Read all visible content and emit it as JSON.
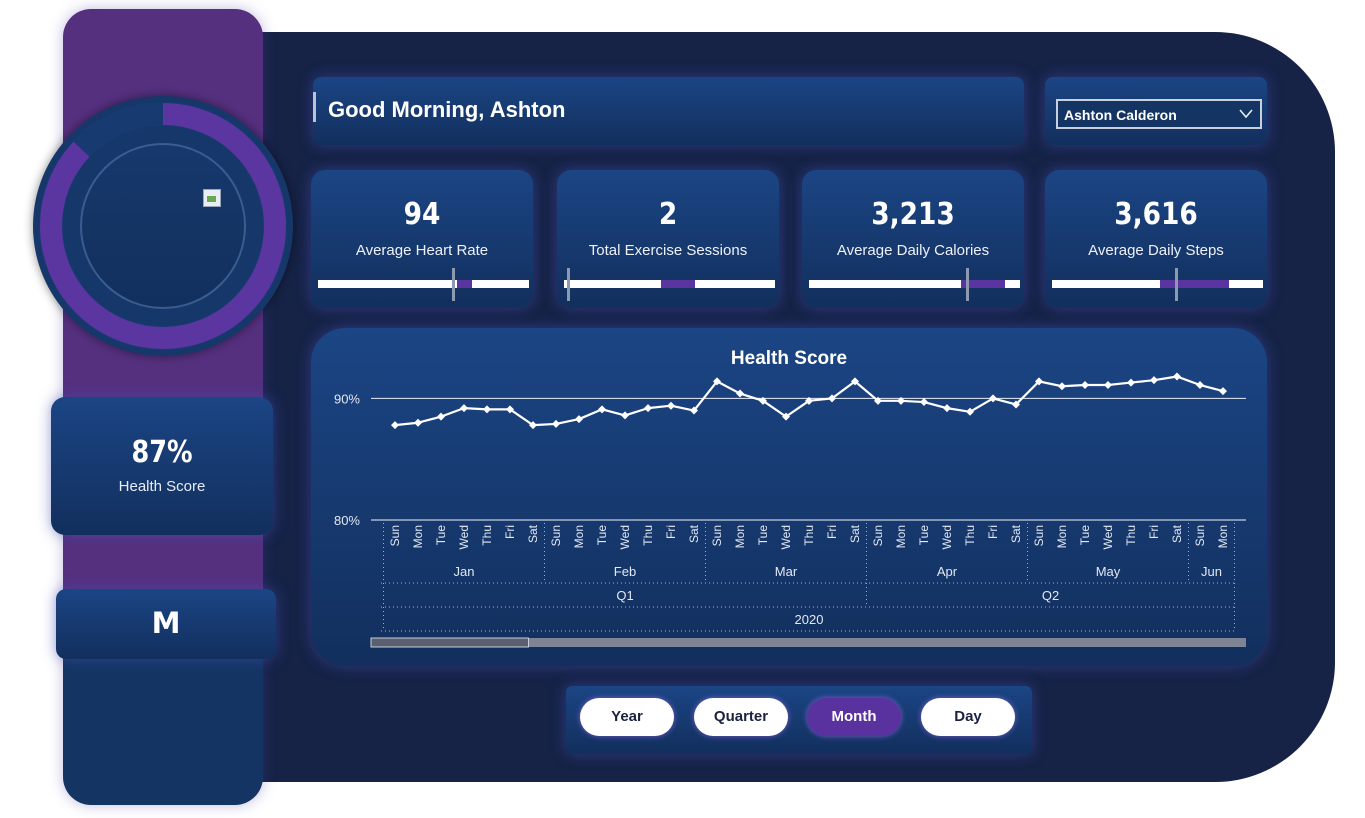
{
  "greeting": "Good Morning, Ashton",
  "user_select": {
    "selected": "Ashton Calderon"
  },
  "sidebar": {
    "health_score": {
      "value": "87%",
      "label": "Health Score",
      "progress": 0.87
    },
    "gender": "M"
  },
  "kpis": [
    {
      "value": "94",
      "label": "Average Heart Rate",
      "target_start": 0.66,
      "target_end": 0.73,
      "marker": 0.64
    },
    {
      "value": "2",
      "label": "Total Exercise Sessions",
      "target_start": 0.46,
      "target_end": 0.62,
      "marker": 0.02
    },
    {
      "value": "3,213",
      "label": "Average Daily Calories",
      "target_start": 0.72,
      "target_end": 0.93,
      "marker": 0.75
    },
    {
      "value": "3,616",
      "label": "Average Daily Steps",
      "target_start": 0.51,
      "target_end": 0.84,
      "marker": 0.59
    }
  ],
  "time_buttons": [
    {
      "label": "Year",
      "active": false
    },
    {
      "label": "Quarter",
      "active": false
    },
    {
      "label": "Month",
      "active": true
    },
    {
      "label": "Day",
      "active": false
    }
  ],
  "colors": {
    "accent": "#5a35a0",
    "panel": "#162347",
    "card": "#1b4584",
    "sidebar_top": "#55307f"
  },
  "chart_data": {
    "type": "line",
    "title": "Health Score",
    "ylim": [
      80,
      92.5
    ],
    "y_ticks": [
      {
        "value": 90,
        "label": "90%"
      },
      {
        "value": 80,
        "label": "80%"
      }
    ],
    "reference_line": 90,
    "x": [
      "Sun",
      "Mon",
      "Tue",
      "Wed",
      "Thu",
      "Fri",
      "Sat",
      "Sun",
      "Mon",
      "Tue",
      "Wed",
      "Thu",
      "Fri",
      "Sat",
      "Sun",
      "Mon",
      "Tue",
      "Wed",
      "Thu",
      "Fri",
      "Sat",
      "Sun",
      "Mon",
      "Tue",
      "Wed",
      "Thu",
      "Fri",
      "Sat",
      "Sun",
      "Mon",
      "Tue",
      "Wed",
      "Thu",
      "Fri",
      "Sat",
      "Sun",
      "Mon"
    ],
    "series": [
      {
        "values": [
          87.8,
          88.0,
          88.5,
          89.2,
          89.1,
          89.1,
          87.8,
          87.9,
          88.3,
          89.1,
          88.6,
          89.2,
          89.4,
          89.0,
          91.4,
          90.4,
          89.8,
          88.5,
          89.8,
          90.0,
          91.4,
          89.8,
          89.8,
          89.7,
          89.2,
          88.9,
          90.0,
          89.5,
          91.4,
          91.0,
          91.1,
          91.1,
          91.3,
          91.5,
          91.8,
          91.1,
          90.6
        ]
      }
    ],
    "months": [
      {
        "label": "Jan",
        "start": 0,
        "end": 6
      },
      {
        "label": "Feb",
        "start": 7,
        "end": 13
      },
      {
        "label": "Mar",
        "start": 14,
        "end": 20
      },
      {
        "label": "Apr",
        "start": 21,
        "end": 27
      },
      {
        "label": "May",
        "start": 28,
        "end": 34
      },
      {
        "label": "Jun",
        "start": 35,
        "end": 36
      }
    ],
    "quarters": [
      {
        "label": "Q1",
        "start": 0,
        "end": 20
      },
      {
        "label": "Q2",
        "start": 21,
        "end": 36
      }
    ],
    "years": [
      {
        "label": "2020",
        "start": 0,
        "end": 36
      }
    ],
    "scroll_position": 0.18
  }
}
